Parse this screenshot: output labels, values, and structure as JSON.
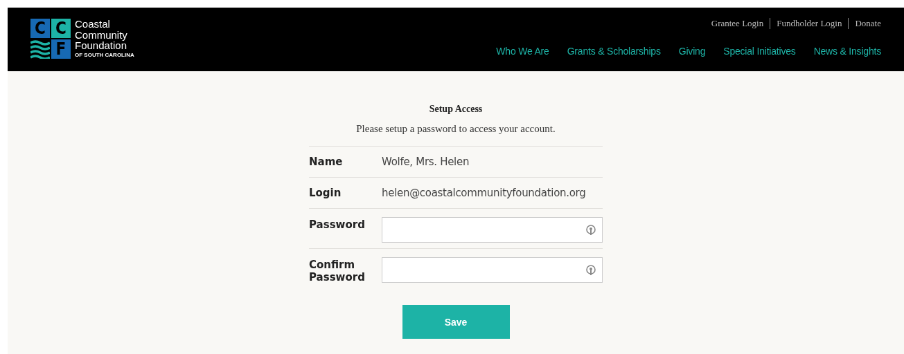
{
  "header": {
    "logo": {
      "letters": [
        "C",
        "C",
        "F"
      ],
      "name_lines": [
        "Coastal",
        "Community",
        "Foundation"
      ],
      "tagline": "OF SOUTH CAROLINA"
    },
    "utility_links": [
      "Grantee Login",
      "Fundholder Login",
      "Donate"
    ],
    "nav": [
      "Who We Are",
      "Grants & Scholarships",
      "Giving",
      "Special Initiatives",
      "News & Insights"
    ]
  },
  "form": {
    "title": "Setup Access",
    "subtitle": "Please setup a password to access your account.",
    "rows": [
      {
        "kind": "text",
        "label": "Name",
        "value": "Wolfe, Mrs. Helen"
      },
      {
        "kind": "text",
        "label": "Login",
        "value": "helen@coastalcommunityfoundation.org"
      },
      {
        "kind": "password",
        "label": "Password"
      },
      {
        "kind": "password",
        "label": "Confirm Password"
      }
    ],
    "button": "Save"
  }
}
